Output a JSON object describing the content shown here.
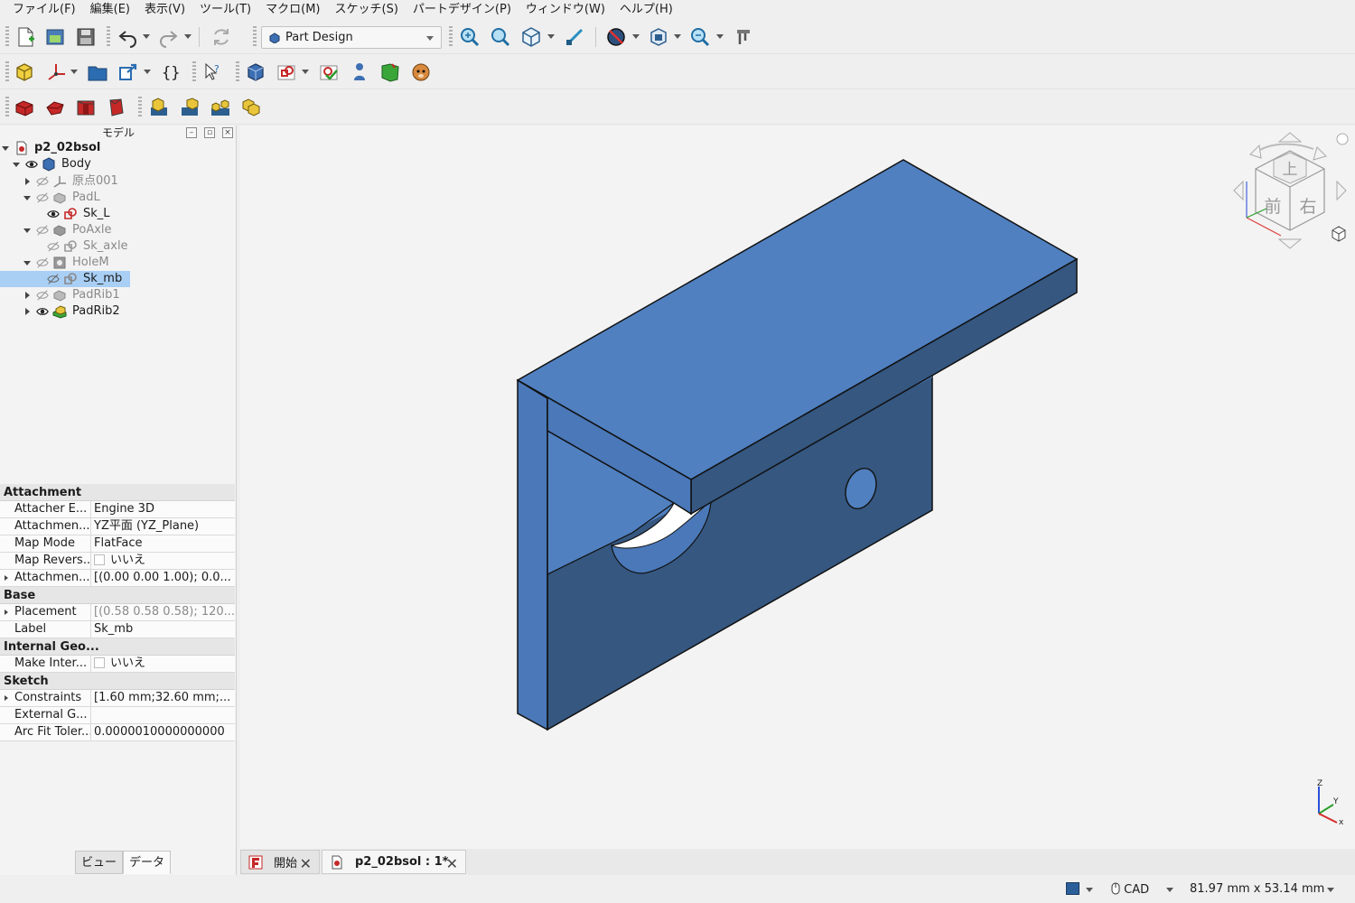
{
  "menu": [
    "ファイル(F)",
    "編集(E)",
    "表示(V)",
    "ツール(T)",
    "マクロ(M)",
    "スケッチ(S)",
    "パートデザイン(P)",
    "ウィンドウ(W)",
    "ヘルプ(H)"
  ],
  "workbench": {
    "selected": "Part Design"
  },
  "panel": {
    "title": "モデル"
  },
  "tree": [
    {
      "label": "p2_02bsol",
      "icon": "document-icon",
      "visible": null
    },
    {
      "label": "Body",
      "icon": "body-icon",
      "visible": true
    },
    {
      "label": "原点001",
      "icon": "origin-icon",
      "visible": false
    },
    {
      "label": "PadL",
      "icon": "pad-icon",
      "visible": false
    },
    {
      "label": "Sk_L",
      "icon": "sketch-icon",
      "visible": true
    },
    {
      "label": "PoAxle",
      "icon": "pad-icon",
      "visible": false
    },
    {
      "label": "Sk_axle",
      "icon": "sketch-icon",
      "visible": false
    },
    {
      "label": "HoleM",
      "icon": "hole-icon",
      "visible": false
    },
    {
      "label": "Sk_mb",
      "icon": "sketch-icon",
      "visible": false,
      "selected": true
    },
    {
      "label": "PadRib1",
      "icon": "pad-icon",
      "visible": false
    },
    {
      "label": "PadRib2",
      "icon": "pad-icon",
      "visible": true
    }
  ],
  "properties": {
    "groups": {
      "attachment": "Attachment",
      "base": "Base",
      "internal": "Internal Geo...",
      "sketch": "Sketch"
    },
    "rows": {
      "attacher_engine": {
        "name": "Attacher E...",
        "value": "Engine 3D"
      },
      "attachment_support": {
        "name": "Attachmen...",
        "value": "YZ平面 (YZ_Plane)"
      },
      "map_mode": {
        "name": "Map Mode",
        "value": "FlatFace"
      },
      "map_reversed": {
        "name": "Map Revers...",
        "value": "いいえ"
      },
      "attachment_offset": {
        "name": "Attachmen...",
        "value": "[(0.00 0.00 1.00); 0.0..."
      },
      "placement": {
        "name": "Placement",
        "value": "[(0.58 0.58 0.58); 120..."
      },
      "label": {
        "name": "Label",
        "value": "Sk_mb"
      },
      "make_internals": {
        "name": "Make Inter...",
        "value": "いいえ"
      },
      "constraints": {
        "name": "Constraints",
        "value": "[1.60 mm;32.60 mm;..."
      },
      "external_geometry": {
        "name": "External G...",
        "value": ""
      },
      "arc_fit_tolerance": {
        "name": "Arc Fit Toler...",
        "value": "0.0000010000000000"
      }
    }
  },
  "panel_tabs": [
    "ビュー",
    "データ"
  ],
  "doc_tabs": [
    {
      "label": "開始",
      "active": false
    },
    {
      "label": "p2_02bsol : 1*",
      "active": true
    }
  ],
  "navcube": {
    "top": "上",
    "front": "前",
    "right": "右"
  },
  "axes": {
    "x": "x",
    "y": "Y",
    "z": "Z"
  },
  "status": {
    "nav_style": "CAD",
    "dimensions": "81.97 mm x 53.14 mm"
  },
  "colors": {
    "model_light": "#5080c0",
    "model_dark": "#355780",
    "selection": "#a9cff5"
  }
}
